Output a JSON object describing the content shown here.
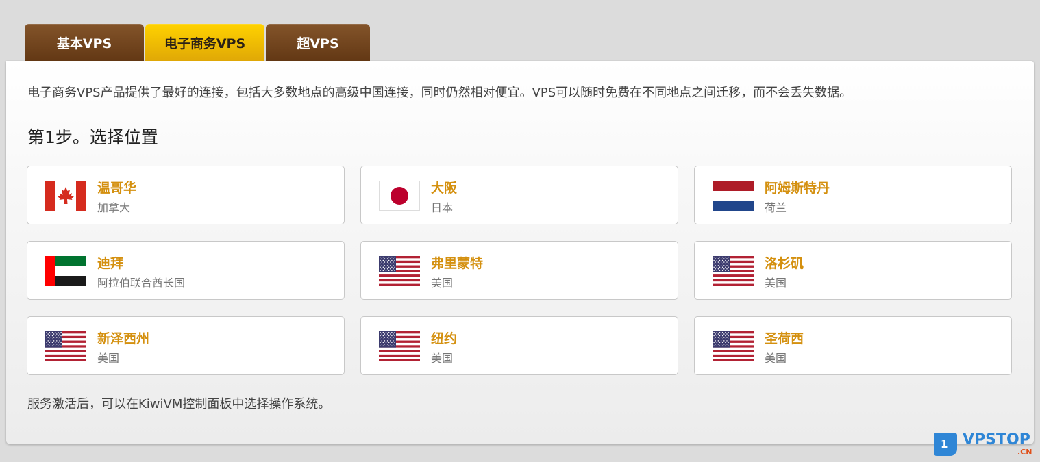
{
  "tabs": [
    {
      "label": "基本VPS",
      "active": false
    },
    {
      "label": "电子商务VPS",
      "active": true
    },
    {
      "label": "超VPS",
      "active": false
    }
  ],
  "intro": "电子商务VPS产品提供了最好的连接，包括大多数地点的高级中国连接，同时仍然相对便宜。VPS可以随时免费在不同地点之间迁移，而不会丢失数据。",
  "step_title": "第1步。选择位置",
  "locations": [
    {
      "city": "温哥华",
      "country": "加拿大",
      "flag": "canada-flag"
    },
    {
      "city": "大阪",
      "country": "日本",
      "flag": "japan-flag"
    },
    {
      "city": "阿姆斯特丹",
      "country": "荷兰",
      "flag": "netherlands-flag"
    },
    {
      "city": "迪拜",
      "country": "阿拉伯联合酋长国",
      "flag": "uae-flag"
    },
    {
      "city": "弗里蒙特",
      "country": "美国",
      "flag": "usa-flag"
    },
    {
      "city": "洛杉矶",
      "country": "美国",
      "flag": "usa-flag"
    },
    {
      "city": "新泽西州",
      "country": "美国",
      "flag": "usa-flag"
    },
    {
      "city": "纽约",
      "country": "美国",
      "flag": "usa-flag"
    },
    {
      "city": "圣荷西",
      "country": "美国",
      "flag": "usa-flag"
    }
  ],
  "footer": "服务激活后，可以在KiwiVM控制面板中选择操作系统。",
  "watermark": {
    "badge": "1",
    "brand": "VPSTOP",
    "suffix": ".CN"
  },
  "colors": {
    "tab_inactive": "#6f4520",
    "tab_active": "#f5c000",
    "city_text": "#d4900f",
    "watermark_blue": "#2f86d6"
  }
}
